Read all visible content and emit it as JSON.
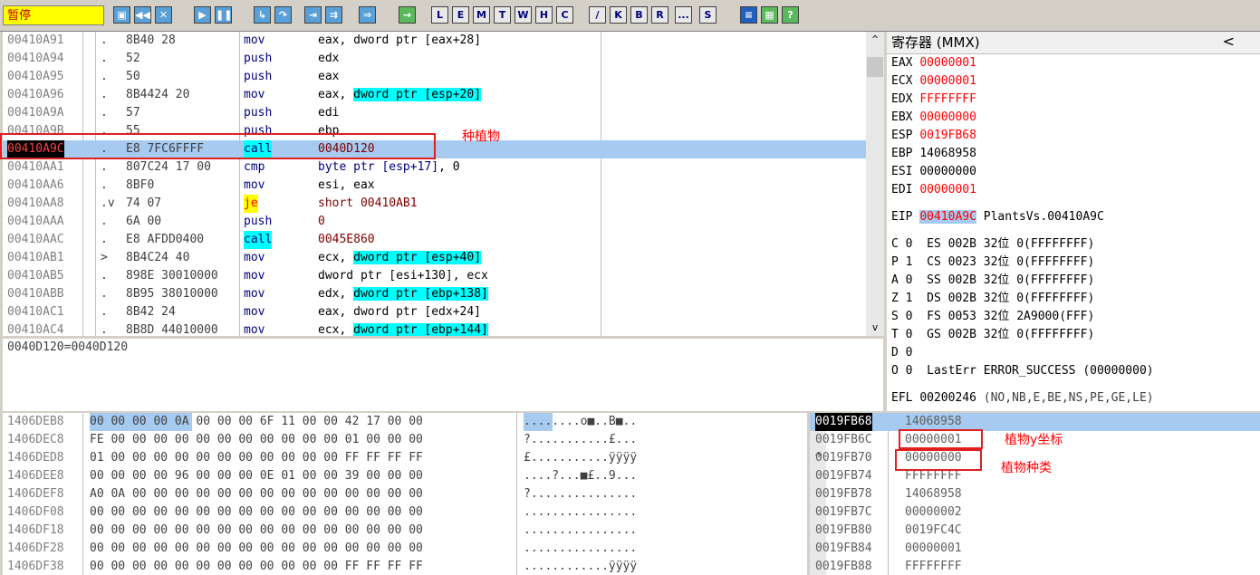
{
  "toolbar": {
    "status": "暂停",
    "letter_buttons": [
      "L",
      "E",
      "M",
      "T",
      "W",
      "H",
      "C",
      "/",
      "K",
      "B",
      "R",
      "...",
      "S"
    ]
  },
  "cpu": {
    "rows": [
      {
        "addr": "00410A91",
        "mark": ".",
        "hex": "8B40 28",
        "mnem": "mov",
        "ops": "eax, ",
        "hi": "dword ptr [eax+28]",
        "hicyan": false,
        "tail": ""
      },
      {
        "addr": "00410A94",
        "mark": ".",
        "hex": "52",
        "mnem": "push",
        "ops": "edx",
        "hi": "",
        "hicyan": false,
        "tail": ""
      },
      {
        "addr": "00410A95",
        "mark": ".",
        "hex": "50",
        "mnem": "push",
        "ops": "eax",
        "hi": "",
        "hicyan": false,
        "tail": ""
      },
      {
        "addr": "00410A96",
        "mark": ".",
        "hex": "8B4424 20",
        "mnem": "mov",
        "ops": "eax, ",
        "hi": "dword ptr [esp+20]",
        "hicyan": true,
        "tail": ""
      },
      {
        "addr": "00410A9A",
        "mark": ".",
        "hex": "57",
        "mnem": "push",
        "ops": "edi",
        "hi": "",
        "hicyan": false,
        "tail": ""
      },
      {
        "addr": "00410A9B",
        "mark": ".",
        "hex": "55",
        "mnem": "push",
        "ops": "ebp",
        "hi": "",
        "hicyan": false,
        "tail": ""
      },
      {
        "addr": "00410A9C",
        "mark": ".",
        "hex": "E8 7FC6FFFF",
        "mnem": "call",
        "ops": "",
        "hi": "0040D120",
        "hicyan": false,
        "tail": ""
      },
      {
        "addr": "00410AA1",
        "mark": ".",
        "hex": "807C24 17 00",
        "mnem": "cmp",
        "ops": "",
        "hi": "byte ptr [esp+17]",
        "hicyan": false,
        "tail": ", 0"
      },
      {
        "addr": "00410AA6",
        "mark": ".",
        "hex": "8BF0",
        "mnem": "mov",
        "ops": "esi, eax",
        "hi": "",
        "hicyan": false,
        "tail": ""
      },
      {
        "addr": "00410AA8",
        "mark": ".v",
        "hex": "74 07",
        "mnem": "je",
        "ops": "",
        "hi": "short 00410AB1",
        "hicyan": false,
        "tail": ""
      },
      {
        "addr": "00410AAA",
        "mark": ".",
        "hex": "6A 00",
        "mnem": "push",
        "ops": "",
        "hi": "0",
        "hicyan": false,
        "tail": ""
      },
      {
        "addr": "00410AAC",
        "mark": ".",
        "hex": "E8 AFDD0400",
        "mnem": "call",
        "ops": "",
        "hi": "0045E860",
        "hicyan": false,
        "tail": ""
      },
      {
        "addr": "00410AB1",
        "mark": ">",
        "hex": "8B4C24 40",
        "mnem": "mov",
        "ops": "ecx, ",
        "hi": "dword ptr [esp+40]",
        "hicyan": true,
        "tail": ""
      },
      {
        "addr": "00410AB5",
        "mark": ".",
        "hex": "898E 30010000",
        "mnem": "mov",
        "ops": "dword ptr [esi+130], ecx",
        "hi": "",
        "hicyan": false,
        "tail": ""
      },
      {
        "addr": "00410ABB",
        "mark": ".",
        "hex": "8B95 38010000",
        "mnem": "mov",
        "ops": "edx, ",
        "hi": "dword ptr [ebp+138]",
        "hicyan": true,
        "tail": ""
      },
      {
        "addr": "00410AC1",
        "mark": ".",
        "hex": "8B42 24",
        "mnem": "mov",
        "ops": "eax, dword ptr [edx+24]",
        "hi": "",
        "hicyan": false,
        "tail": ""
      },
      {
        "addr": "00410AC4",
        "mark": ".",
        "hex": "8B8D 44010000",
        "mnem": "mov",
        "ops": "ecx, ",
        "hi": "dword ptr [ebp+144]",
        "hicyan": true,
        "tail": ""
      }
    ],
    "annotation": "种植物"
  },
  "hint": "0040D120=0040D120",
  "registers": {
    "title": "寄存器 (MMX)",
    "collapse": "<",
    "gp": [
      {
        "name": "EAX",
        "value": "00000001",
        "changed": true
      },
      {
        "name": "ECX",
        "value": "00000001",
        "changed": true
      },
      {
        "name": "EDX",
        "value": "FFFFFFFF",
        "changed": true
      },
      {
        "name": "EBX",
        "value": "00000000",
        "changed": true
      },
      {
        "name": "ESP",
        "value": "0019FB68",
        "changed": true
      },
      {
        "name": "EBP",
        "value": "14068958",
        "changed": false
      },
      {
        "name": "ESI",
        "value": "00000000",
        "changed": false
      },
      {
        "name": "EDI",
        "value": "00000001",
        "changed": true
      }
    ],
    "eip": {
      "name": "EIP",
      "value": "00410A9C",
      "label": "PlantsVs.00410A9C"
    },
    "flags": [
      {
        "flag": "C 0",
        "seg": "ES 002B 32位 0(FFFFFFFF)"
      },
      {
        "flag": "P 1",
        "seg": "CS 0023 32位 0(FFFFFFFF)"
      },
      {
        "flag": "A 0",
        "seg": "SS 002B 32位 0(FFFFFFFF)"
      },
      {
        "flag": "Z 1",
        "seg": "DS 002B 32位 0(FFFFFFFF)"
      },
      {
        "flag": "S 0",
        "seg": "FS 0053 32位 2A9000(FFF)"
      },
      {
        "flag": "T 0",
        "seg": "GS 002B 32位 0(FFFFFFFF)"
      },
      {
        "flag": "D 0",
        "seg": ""
      },
      {
        "flag": "O 0",
        "seg": "LastErr ERROR_SUCCESS (00000000)"
      }
    ],
    "efl": {
      "name": "EFL",
      "value": "00200246",
      "desc": "(NO,NB,E,BE,NS,PE,GE,LE)"
    }
  },
  "dump": {
    "rows": [
      {
        "addr": "1406DEB8",
        "hex": "00 00 00 00 0A 00 00 00 6F 11 00 00 42 17 00 00",
        "ascii": "........o■..B■.."
      },
      {
        "addr": "1406DEC8",
        "hex": "FE 00 00 00 00 00 00 00 00 00 00 00 01 00 00 00",
        "ascii": "?...........£..."
      },
      {
        "addr": "1406DED8",
        "hex": "01 00 00 00 00 00 00 00 00 00 00 00 FF FF FF FF",
        "ascii": "£...........ÿÿÿÿ"
      },
      {
        "addr": "1406DEE8",
        "hex": "00 00 00 00 96 00 00 00 0E 01 00 00 39 00 00 00",
        "ascii": "....?...■£..9..."
      },
      {
        "addr": "1406DEF8",
        "hex": "A0 0A 00 00 00 00 00 00 00 00 00 00 00 00 00 00",
        "ascii": "?..............."
      },
      {
        "addr": "1406DF08",
        "hex": "00 00 00 00 00 00 00 00 00 00 00 00 00 00 00 00",
        "ascii": "................"
      },
      {
        "addr": "1406DF18",
        "hex": "00 00 00 00 00 00 00 00 00 00 00 00 00 00 00 00",
        "ascii": "................"
      },
      {
        "addr": "1406DF28",
        "hex": "00 00 00 00 00 00 00 00 00 00 00 00 00 00 00 00",
        "ascii": "................"
      },
      {
        "addr": "1406DF38",
        "hex": "00 00 00 00 00 00 00 00 00 00 00 00 FF FF FF FF",
        "ascii": "............ÿÿÿÿ"
      }
    ]
  },
  "stack": {
    "rows": [
      {
        "addr": "0019FB68",
        "value": "14068958"
      },
      {
        "addr": "0019FB6C",
        "value": "00000001"
      },
      {
        "addr": "0019FB70",
        "value": "00000000"
      },
      {
        "addr": "0019FB74",
        "value": "FFFFFFFF"
      },
      {
        "addr": "0019FB78",
        "value": "14068958"
      },
      {
        "addr": "0019FB7C",
        "value": "00000002"
      },
      {
        "addr": "0019FB80",
        "value": "0019FC4C"
      },
      {
        "addr": "0019FB84",
        "value": "00000001"
      },
      {
        "addr": "0019FB88",
        "value": "FFFFFFFF"
      }
    ],
    "annotations": [
      "植物y坐标",
      "植物种类"
    ]
  },
  "colors": {
    "changed": "#ff0000",
    "eip_bg": "#a6caf0",
    "cyan": "#00ffff",
    "annotation": "#e02020"
  }
}
